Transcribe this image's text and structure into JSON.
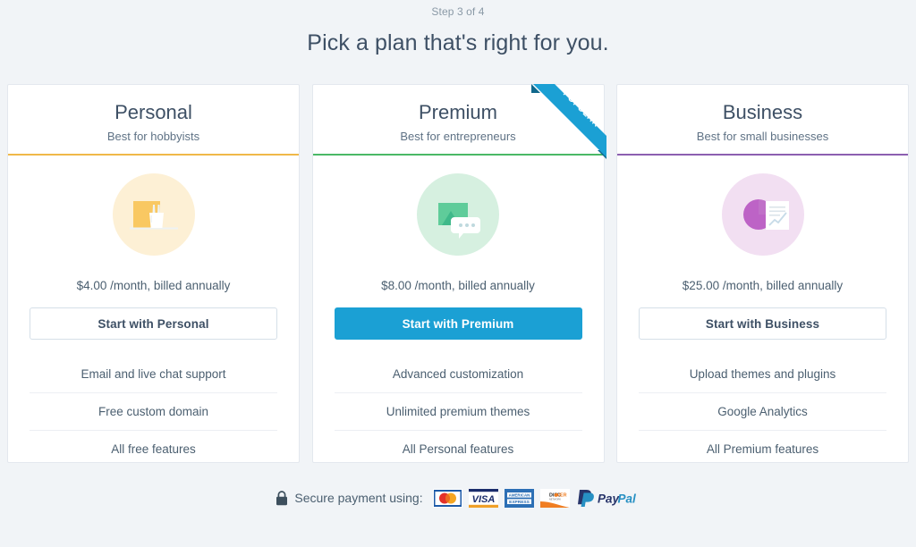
{
  "header": {
    "step_label": "Step 3 of 4",
    "headline": "Pick a plan that's right for you."
  },
  "colors": {
    "page_background": "#f1f4f7",
    "card_background": "#ffffff",
    "personal_accent": "#f0b849",
    "premium_accent": "#4ab866",
    "business_accent": "#8c5fb0",
    "primary_button": "#1ba0d4",
    "ribbon": "#1ba0d4",
    "ribbon_fold": "#10688c",
    "heading_text": "#3e5065",
    "body_text": "#4b5f70"
  },
  "plans": [
    {
      "name": "Personal",
      "tagline": "Best for hobbyists",
      "accent": "#f0b849",
      "icon": "pencil-cup-icon",
      "icon_bg": "#fdf0d5",
      "icon_color": "#f9c55a",
      "price": "$4.00 /month, billed annually",
      "cta_label": "Start with Personal",
      "cta_style": "outline",
      "popular": false,
      "features": [
        "Email and live chat support",
        "Free custom domain",
        "All free features"
      ]
    },
    {
      "name": "Premium",
      "tagline": "Best for entrepreneurs",
      "accent": "#4ab866",
      "icon": "chat-image-icon",
      "icon_bg": "#d6f0e0",
      "icon_color": "#5fcc9a",
      "price": "$8.00 /month, billed annually",
      "cta_label": "Start with Premium",
      "cta_style": "solid",
      "popular": true,
      "ribbon_label": "POPULAR",
      "features": [
        "Advanced customization",
        "Unlimited premium themes",
        "All Personal features"
      ]
    },
    {
      "name": "Business",
      "tagline": "Best for small businesses",
      "accent": "#8c5fb0",
      "icon": "pie-chart-document-icon",
      "icon_bg": "#f2dff2",
      "icon_color": "#c070c8",
      "price": "$25.00 /month, billed annually",
      "cta_label": "Start with Business",
      "cta_style": "outline",
      "popular": false,
      "features": [
        "Upload themes and plugins",
        "Google Analytics",
        "All Premium features"
      ]
    }
  ],
  "footer": {
    "lock_icon": "lock-icon",
    "secure_text": "Secure payment using:",
    "payment_methods": [
      {
        "name": "mastercard-logo",
        "label": "MasterCard"
      },
      {
        "name": "visa-logo",
        "label": "VISA"
      },
      {
        "name": "amex-logo",
        "label": "AMERICAN EXPRESS"
      },
      {
        "name": "discover-logo",
        "label": "DISCOVER"
      },
      {
        "name": "paypal-logo",
        "label": "PayPal"
      }
    ]
  }
}
